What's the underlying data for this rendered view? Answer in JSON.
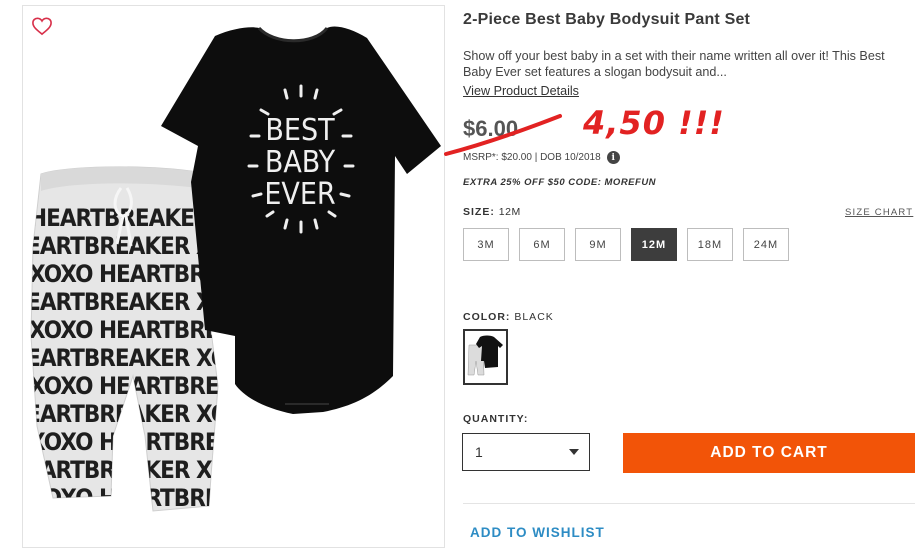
{
  "product": {
    "title": "2-Piece Best Baby Bodysuit Pant Set",
    "description": "Show off your best baby in a set with their name written all over it! This Best Baby Ever set features a slogan bodysuit and...",
    "details_link": "View Product Details",
    "bodysuit_text": [
      "BEST",
      "BABY",
      "EVER"
    ],
    "pants_text": [
      "HEARTBREAKER XOXO",
      "HEARTBREAKER XOXO",
      "XOXO HEARTBREAKER",
      "HEARTBREAKER XOXO",
      "XOXO HEARTBREAKER",
      "HEARTBREAKER XOXO",
      "XOXO HEARTBREAKER",
      "HEARTBREAKER XOXO",
      "XOXO HEARTBREAKER",
      "HEARTBREAKER XOXO",
      "XOXO HEARTBREAKER",
      "HEARTBREAKER XOXO"
    ]
  },
  "price": {
    "old_price": "$6.00",
    "handwritten_note": "4,50 !!!",
    "msrp_text": "MSRP*: $20.00 | DOB 10/2018",
    "info_icon": "i",
    "promo": "EXTRA 25% OFF $50 CODE: MOREFUN",
    "strike_color": "#e22222"
  },
  "size": {
    "label": "SIZE:",
    "selected": "12M",
    "chart_link": "SIZE CHART",
    "options": [
      "3M",
      "6M",
      "9M",
      "12M",
      "18M",
      "24M"
    ]
  },
  "color": {
    "label": "COLOR:",
    "selected": "BLACK"
  },
  "quantity": {
    "label": "QUANTITY:",
    "value": "1"
  },
  "actions": {
    "add_to_cart": "ADD TO CART",
    "add_to_wishlist": "ADD TO WISHLIST",
    "accent_color": "#f25408",
    "link_color": "#2d8cc4"
  },
  "icons": {
    "favorite": "heart-outline-icon",
    "dropdown": "chevron-down-icon",
    "info": "info-icon"
  }
}
